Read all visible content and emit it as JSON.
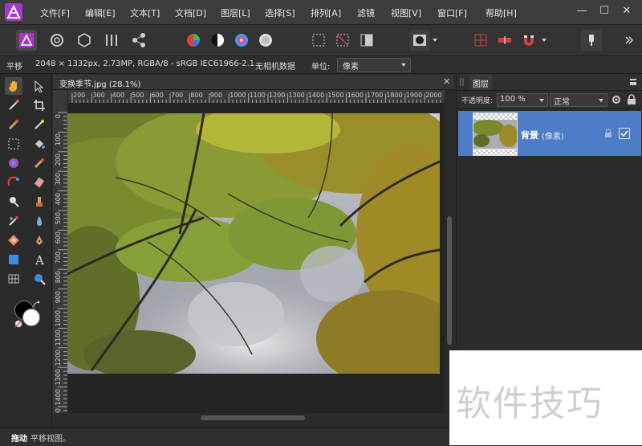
{
  "menubar": {
    "items": [
      "文件[F]",
      "编辑[E]",
      "文本[T]",
      "文档[D]",
      "图层[L]",
      "选择[S]",
      "排列[A]",
      "滤镜",
      "视图[V]",
      "窗口[F]",
      "帮助[H]"
    ],
    "window_buttons": [
      "—",
      "☐",
      "✕"
    ]
  },
  "context": {
    "tool_name": "平移",
    "image_info": "2048 × 1332px, 2.73MP, RGBA/8 - sRGB IEC61966-2.1",
    "camera_data": "无相机数据",
    "units_label": "单位:",
    "units_value": "像素"
  },
  "document": {
    "tab_title": "变换季节.jpg (28.1%)",
    "close": "✕",
    "ruler_unit": "px",
    "hruler_labels": [
      "200",
      "300",
      "400",
      "500",
      "600",
      "700",
      "800",
      "900",
      "1000",
      "1100",
      "1200",
      "1300",
      "1400",
      "1500",
      "1600",
      "1700",
      "1800",
      "1900",
      "2000"
    ],
    "vruler_labels": [
      "0",
      "100",
      "200",
      "300",
      "400",
      "500",
      "600",
      "700",
      "800",
      "900",
      "1000",
      "1100",
      "1200",
      "1300",
      "1400",
      "1500"
    ]
  },
  "layers": {
    "tab_label": "图层",
    "opacity_label": "不透明度:",
    "opacity_value": "100 %",
    "blend_mode": "正常",
    "layer_name": "背景",
    "layer_type": "(像素)"
  },
  "status": {
    "action": "拖动",
    "hint": "平移视图。"
  },
  "watermark": {
    "text": "软件技巧"
  },
  "colors": {
    "accent": "#4e7cc7",
    "logo": "#a239c9"
  }
}
